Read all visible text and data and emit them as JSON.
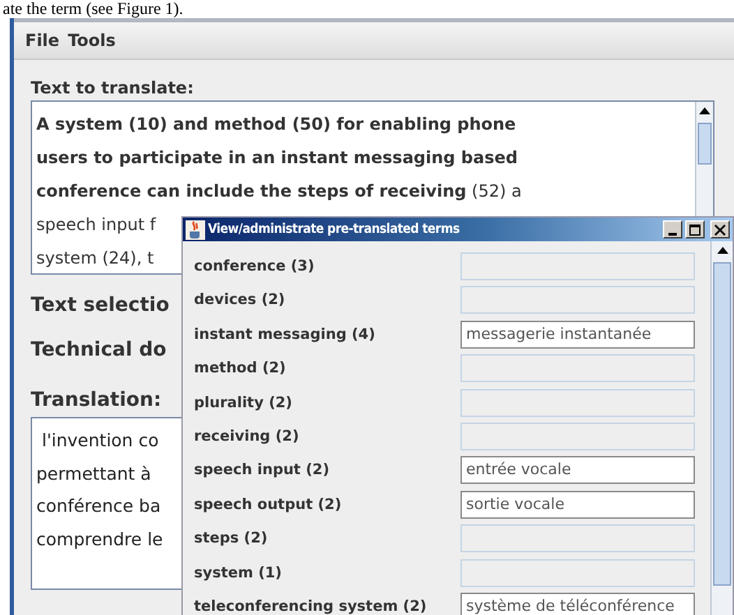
{
  "document_text": "ate the term (see Figure 1).",
  "menu": [
    "File",
    "Tools"
  ],
  "source": {
    "label": "Text to translate:",
    "lines": [
      "**A system (10) and method (50) for enabling phone**",
      "**users to participate in an instant messaging based**",
      "**conference can include the steps of receiving** (52) a",
      "speech input f",
      "system (24), t"
    ]
  },
  "text_selection": {
    "label": "Text selectio"
  },
  "technical_domain": {
    "label": "Technical do"
  },
  "translation": {
    "label": "Translation:",
    "lines": [
      " l'invention co",
      "permettant à",
      "conférence ba",
      "comprendre le"
    ]
  },
  "dialog": {
    "title": "View/administrate pre-translated terms",
    "terms": [
      {
        "term": "conference (3)",
        "editable": false
      },
      {
        "term": "devices (2)",
        "editable": false
      },
      {
        "term": "instant messaging (4)",
        "editable": true,
        "value": "messagerie instantanée"
      },
      {
        "term": "method (2)",
        "editable": false
      },
      {
        "term": "plurality (2)",
        "editable": false
      },
      {
        "term": "receiving (2)",
        "editable": false
      },
      {
        "term": "speech input (2)",
        "editable": true,
        "value": "entrée vocale"
      },
      {
        "term": "speech output (2)",
        "editable": true,
        "value": "sortie vocale"
      },
      {
        "term": "steps (2)",
        "editable": false
      },
      {
        "term": "system (1)",
        "editable": false
      },
      {
        "term": "teleconferencing system (2)",
        "editable": true,
        "value": "système de téléconférence"
      }
    ]
  }
}
